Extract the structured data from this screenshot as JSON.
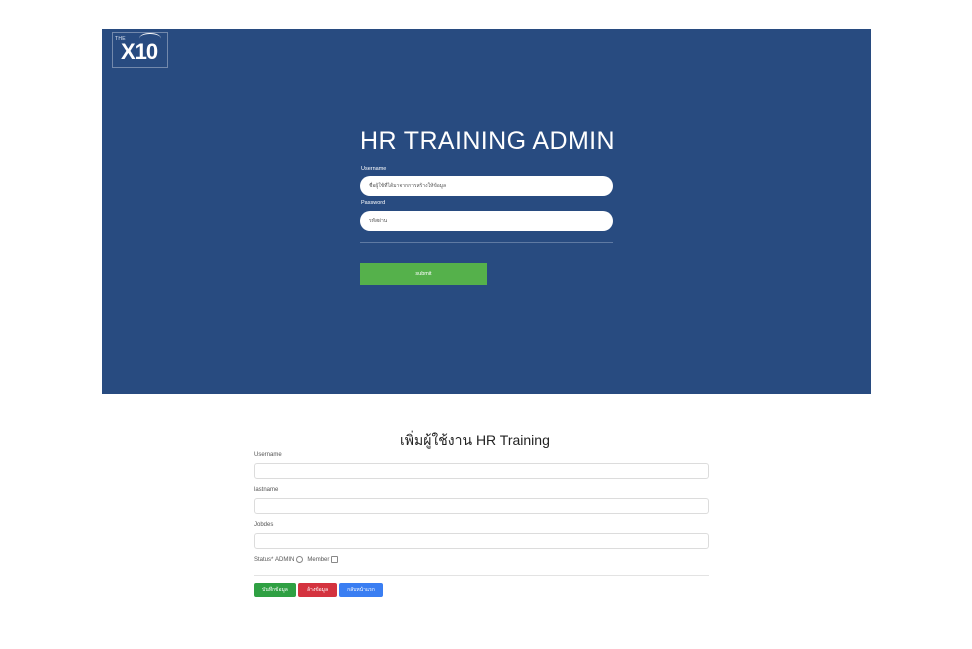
{
  "login": {
    "logo_small": "THE",
    "logo_text": "X10",
    "title": "HR TRAINING ADMIN",
    "username_label": "Username",
    "username_placeholder": "ชื่อผู้ใช้ที่ได้มาจากการสร้างให้ข้อมูล",
    "password_label": "Password",
    "password_placeholder": "รหัสผ่าน",
    "submit_label": "submit",
    "colors": {
      "panel": "#284b80",
      "submit": "#55b14b"
    }
  },
  "form": {
    "title": "เพิ่มผู้ใช้งาน HR Training",
    "username_label": "Username",
    "lastname_label": "lastname",
    "jobdes_label": "Jobdes",
    "status_label": "Status*",
    "status_admin": "ADMIN",
    "status_member": "Member",
    "save_label": "บันทึกข้อมูล",
    "clear_label": "ล้างข้อมูล",
    "back_label": "กลับหน้าแรก",
    "colors": {
      "save": "#2fa043",
      "clear": "#d4333f",
      "back": "#3a7ef2"
    }
  }
}
